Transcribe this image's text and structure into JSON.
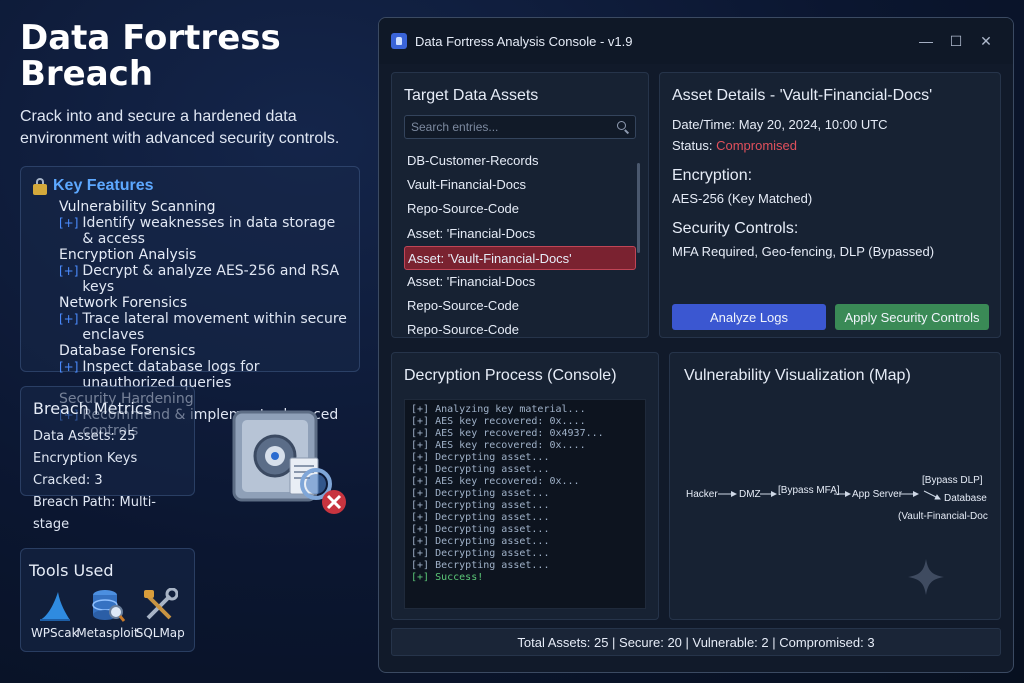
{
  "promo": {
    "title": "Data Fortress Breach",
    "subtitle": "Crack into and secure a hardened data environment with advanced security controls.",
    "features_heading": "Key Features",
    "features": [
      {
        "title": "Vulnerability Scanning",
        "desc": "Identify weaknesses in data storage & access"
      },
      {
        "title": "Encryption Analysis",
        "desc": "Decrypt & analyze AES-256 and RSA keys"
      },
      {
        "title": "Network Forensics",
        "desc": "Trace lateral movement within secure enclaves"
      },
      {
        "title": "Database Forensics",
        "desc": "Inspect database logs for unauthorized queries"
      },
      {
        "title": "Security Hardening",
        "desc": "Recommend & implement advanced controls"
      }
    ],
    "plus_glyph": "[+]",
    "metrics_heading": "Breach Metrics",
    "metrics": [
      "Data Assets: 25",
      "Encryption Keys Cracked: 3",
      "Breach Path: Multi-stage"
    ],
    "tools_heading": "Tools Used",
    "tools": [
      {
        "label": "WPScak",
        "icon": "shark-fin-icon"
      },
      {
        "label": "Metasploit",
        "icon": "database-search-icon"
      },
      {
        "label": "SQLMap",
        "icon": "tools-icon"
      }
    ]
  },
  "window": {
    "title": "Data Fortress Analysis Console - v1.9",
    "controls": {
      "minimize": "—",
      "maximize": "☐",
      "close": "✕"
    }
  },
  "targets": {
    "heading": "Target Data Assets",
    "search_placeholder": "Search entries...",
    "items": [
      "DB-Customer-Records",
      "Vault-Financial-Docs",
      "Repo-Source-Code",
      "Asset: 'Financial-Docs",
      "Asset: 'Vault-Financial-Docs'",
      "Asset: 'Financial-Docs",
      "Repo-Source-Code",
      "Repo-Source-Code"
    ],
    "selected_index": 4
  },
  "details": {
    "heading": "Asset Details - 'Vault-Financial-Docs'",
    "datetime": "Date/Time: May 20, 2024, 10:00 UTC",
    "status_label": "Status: ",
    "status_value": "Compromised",
    "encryption_heading": "Encryption:",
    "encryption_value": "AES-256 (Key Matched)",
    "controls_heading": "Security Controls:",
    "controls_value": "MFA Required, Geo-fencing, DLP (Bypassed)",
    "analyze_button": "Analyze Logs",
    "apply_button": "Apply Security Controls"
  },
  "console": {
    "heading": "Decryption Process (Console)",
    "lines": [
      "[+] Analyzing key material...",
      "[+] AES key recovered: 0x....",
      "[+] AES key recovered: 0x4937...",
      "[+] AES key recovered: 0x....",
      "[+] Decrypting asset...",
      "[+] Decrypting asset...",
      "[+] AES key recovered: 0x...",
      "[+] Decrypting asset...",
      "[+] Decrypting asset...",
      "[+] Decrypting asset...",
      "[+] Decrypting asset...",
      "[+] Decrypting asset...",
      "[+] Decrypting asset...",
      "[+] Becrypting asset..."
    ],
    "success_line": "[+] Success!"
  },
  "map": {
    "heading": "Vulnerability Visualization (Map)",
    "nodes": [
      "Hacker",
      "DMZ",
      "[Bypass MFA]",
      "App Server",
      "[Bypass DLP]",
      "Database",
      "(Vault-Financial-Docs)"
    ]
  },
  "status_bar": "Total Assets: 25 | Secure: 20 | Vulnerable: 2 | Compromised: 3",
  "colors": {
    "accent_blue": "#3b57d1",
    "accent_green": "#3a8a56",
    "danger": "#e0505c",
    "selected_row": "#7a2230"
  }
}
